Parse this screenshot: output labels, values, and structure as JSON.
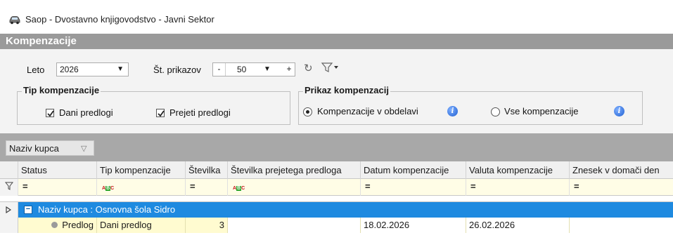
{
  "window": {
    "title": "Saop - Dvostavno knjigovodstvo - Javni Sektor",
    "icon": "car-icon"
  },
  "section": {
    "title": "Kompenzacije"
  },
  "toolbar": {
    "year_label": "Leto",
    "year_value": "2026",
    "count_label": "Št. prikazov",
    "count_minus": "-",
    "count_value": "50",
    "count_plus": "+",
    "refresh_icon": "refresh-icon",
    "filter_icon": "filter-dropdown-icon"
  },
  "tip_group": {
    "title": "Tip kompenzacije",
    "options": [
      {
        "label": "Dani predlogi",
        "checked": true
      },
      {
        "label": "Prejeti predlogi",
        "checked": true
      }
    ]
  },
  "prikaz_group": {
    "title": "Prikaz kompenzacij",
    "options": [
      {
        "label": "Kompenzacije v obdelavi",
        "selected": true
      },
      {
        "label": "Vse kompenzacije",
        "selected": false
      }
    ]
  },
  "group_by": {
    "chip_label": "Naziv kupca"
  },
  "grid": {
    "columns": [
      "Status",
      "Tip kompenzacije",
      "Številka",
      "Številka prejetega predloga",
      "Datum kompenzacije",
      "Valuta kompenzacije",
      "Znesek v domači den"
    ],
    "filter_row": [
      "=",
      "ABC",
      "=",
      "ABC",
      "=",
      "=",
      "="
    ],
    "group_row": {
      "label": "Naziv kupca : Osnovna šola Sidro",
      "expanded": true
    },
    "rows": [
      {
        "status": "Predlog",
        "tip": "Dani predlog",
        "stevilka": "3",
        "prejeti": "",
        "datum": "18.02.2026",
        "valuta": "26.02.2026",
        "znesek": ""
      }
    ]
  },
  "colors": {
    "header_bg": "#9a9a9a",
    "group_band": "#1e8ae0",
    "row_highlight": "#fffbd0",
    "filter_row": "#fffde6"
  }
}
